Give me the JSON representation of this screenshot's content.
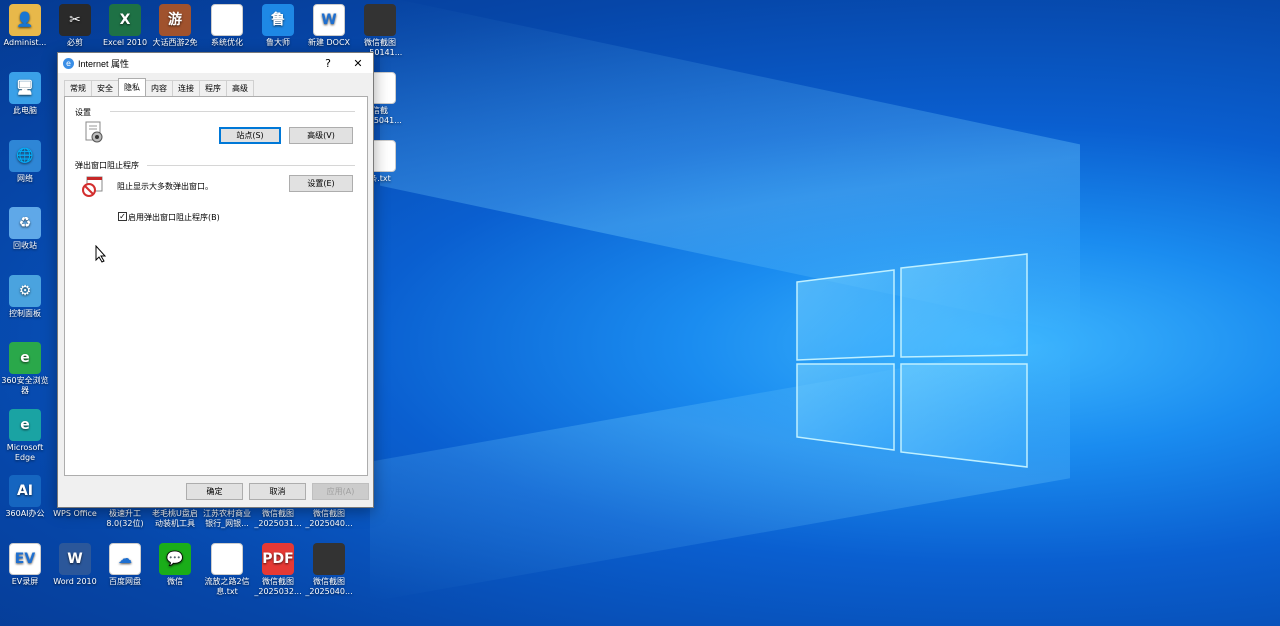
{
  "desktop_icons": [
    {
      "label": "Administ...",
      "icon": "user-folder-icon",
      "color": "#e8b84a",
      "glyph": "👤"
    },
    {
      "label": "必剪",
      "icon": "bijian-icon",
      "color": "#2a2a2a",
      "glyph": "✂"
    },
    {
      "label": "Excel 2010",
      "icon": "excel-icon",
      "color": "#1e7145",
      "glyph": "X"
    },
    {
      "label": "大话西游2免",
      "icon": "game-icon",
      "color": "#a0522d",
      "glyph": "游"
    },
    {
      "label": "系统优化",
      "icon": "system-optimize-icon",
      "color": "#ffffff",
      "glyph": ""
    },
    {
      "label": "鲁大师",
      "icon": "ludashi-icon",
      "color": "#1e88e5",
      "glyph": "鲁"
    },
    {
      "label": "新建 DOCX",
      "icon": "word-doc-icon",
      "color": "#ffffff",
      "glyph": "W"
    },
    {
      "label": "微信截图_...50141...",
      "icon": "screenshot-icon",
      "color": "#333333",
      "glyph": ""
    },
    {
      "label": "此电脑",
      "icon": "computer-icon",
      "color": "#3aa0e8",
      "glyph": "🖥"
    },
    {
      "label": "信截图...5041...",
      "icon": "screenshot-icon",
      "color": "#ffffff",
      "glyph": ""
    },
    {
      "label": "网络",
      "icon": "network-icon",
      "color": "#2e86d6",
      "glyph": "🌐"
    },
    {
      "label": "条.txt",
      "icon": "text-file-icon",
      "color": "#ffffff",
      "glyph": ""
    },
    {
      "label": "回收站",
      "icon": "recycle-bin-icon",
      "color": "#5fa8e8",
      "glyph": "♻"
    },
    {
      "label": "控制面板",
      "icon": "control-panel-icon",
      "color": "#4aa3df",
      "glyph": "⚙"
    },
    {
      "label": "360安全浏览器",
      "icon": "360-browser-icon",
      "color": "#2aa84a",
      "glyph": "e"
    },
    {
      "label": "Microsoft Edge",
      "icon": "edge-icon",
      "color": "#1aa3a3",
      "glyph": "e"
    },
    {
      "label": "360AI办公",
      "icon": "360ai-icon",
      "color": "#1565c0",
      "glyph": "AI"
    },
    {
      "label": "WPS Office",
      "icon": "wps-icon",
      "color": "#d32f2f",
      "glyph": "W"
    },
    {
      "label": "极速升工8.0(32位)",
      "icon": "app-icon",
      "color": "#1565c0",
      "glyph": ""
    },
    {
      "label": "老毛桃U盘启动装机工具",
      "icon": "app-icon",
      "color": "#ef6c00",
      "glyph": ""
    },
    {
      "label": "江苏农村商业银行_网银...",
      "icon": "bank-icon",
      "color": "#2e7d32",
      "glyph": ""
    },
    {
      "label": "微信截图_2025031...",
      "icon": "screenshot-icon",
      "color": "#333333",
      "glyph": ""
    },
    {
      "label": "微信截图_2025040...",
      "icon": "screenshot-icon",
      "color": "#333333",
      "glyph": ""
    },
    {
      "label": "EV录屏",
      "icon": "ev-recorder-icon",
      "color": "#ffffff",
      "glyph": "EV"
    },
    {
      "label": "Word 2010",
      "icon": "word-icon",
      "color": "#2b579a",
      "glyph": "W"
    },
    {
      "label": "百度网盘",
      "icon": "baidu-netdisk-icon",
      "color": "#ffffff",
      "glyph": "☁"
    },
    {
      "label": "微信",
      "icon": "wechat-icon",
      "color": "#1aad19",
      "glyph": "💬"
    },
    {
      "label": "流放之路2信息.txt",
      "icon": "text-file-icon",
      "color": "#ffffff",
      "glyph": ""
    },
    {
      "label": "微信截图_2025032...",
      "icon": "pdf-icon",
      "color": "#e53935",
      "glyph": "PDF"
    },
    {
      "label": "微信截图_2025040...",
      "icon": "screenshot-icon",
      "color": "#333333",
      "glyph": ""
    }
  ],
  "dialog": {
    "title": "Internet 属性",
    "help": "?",
    "close": "✕",
    "tabs": [
      "常规",
      "安全",
      "隐私",
      "内容",
      "连接",
      "程序",
      "高级"
    ],
    "active_tab": 2,
    "settings_group": "设置",
    "sites_button": "站点(S)",
    "advanced_button": "高级(V)",
    "popup_group": "弹出窗口阻止程序",
    "popup_desc": "阻止显示大多数弹出窗口。",
    "popup_settings_button": "设置(E)",
    "popup_check_label": "启用弹出窗口阻止程序(B)",
    "popup_checked": true,
    "ok_button": "确定",
    "cancel_button": "取消",
    "apply_button": "应用(A)"
  }
}
